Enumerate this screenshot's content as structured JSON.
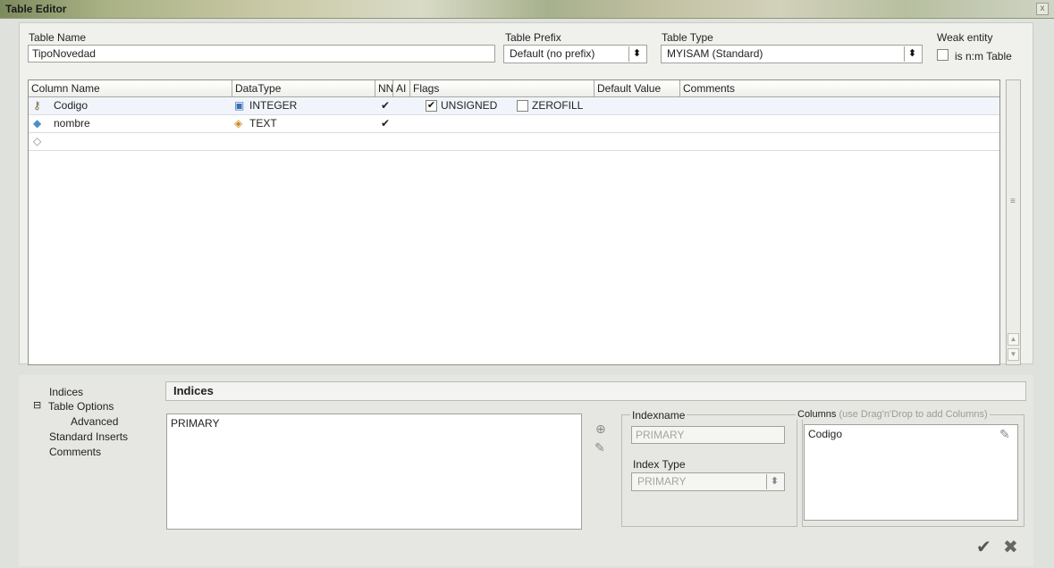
{
  "window": {
    "title": "Table Editor",
    "close_glyph": "x"
  },
  "table_name": {
    "label": "Table Name",
    "value": "TipoNovedad"
  },
  "table_prefix": {
    "label": "Table Prefix",
    "value": "Default (no prefix)"
  },
  "table_type": {
    "label": "Table Type",
    "value": "MYISAM  (Standard)"
  },
  "weak_entity": {
    "label": "Weak entity",
    "checkbox_label": "is n:m Table",
    "checked": false
  },
  "columns_grid": {
    "headers": [
      "Column Name",
      "DataType",
      "NN",
      "AI",
      "Flags",
      "Default Value",
      "Comments"
    ],
    "rows": [
      {
        "name": "Codigo",
        "type": "INTEGER",
        "nn": "✔",
        "flags": [
          {
            "label": "UNSIGNED",
            "checked": true
          },
          {
            "label": "ZEROFILL",
            "checked": false
          }
        ],
        "key_icon": "key-icon",
        "type_icon": "integer-type-icon"
      },
      {
        "name": "nombre",
        "type": "TEXT",
        "nn": "✔",
        "flags": [],
        "key_icon": "column-dot-icon",
        "type_icon": "text-type-icon"
      },
      {
        "name": "",
        "type": "",
        "nn": "",
        "flags": [],
        "key_icon": "new-row-diamond-icon"
      }
    ]
  },
  "nav": {
    "items": [
      "Indices",
      "Table Options",
      "Advanced",
      "Standard Inserts",
      "Comments"
    ],
    "expander_glyph": "⊟"
  },
  "indices": {
    "section_title": "Indices",
    "list": [
      "PRIMARY"
    ],
    "indexname_label": "Indexname",
    "indexname_value": "PRIMARY",
    "index_type_label": "Index Type",
    "index_type_value": "PRIMARY",
    "columns_label": "Columns",
    "columns_hint": "(use Drag'n'Drop to add Columns)",
    "columns_list": [
      "Codigo"
    ]
  },
  "actions": {
    "confirm_glyph": "✔",
    "cancel_glyph": "✖"
  },
  "colors": {
    "titlebar": "#a9b285",
    "selected_row": "#f1f5fb",
    "panel": "#f0f0ed"
  }
}
